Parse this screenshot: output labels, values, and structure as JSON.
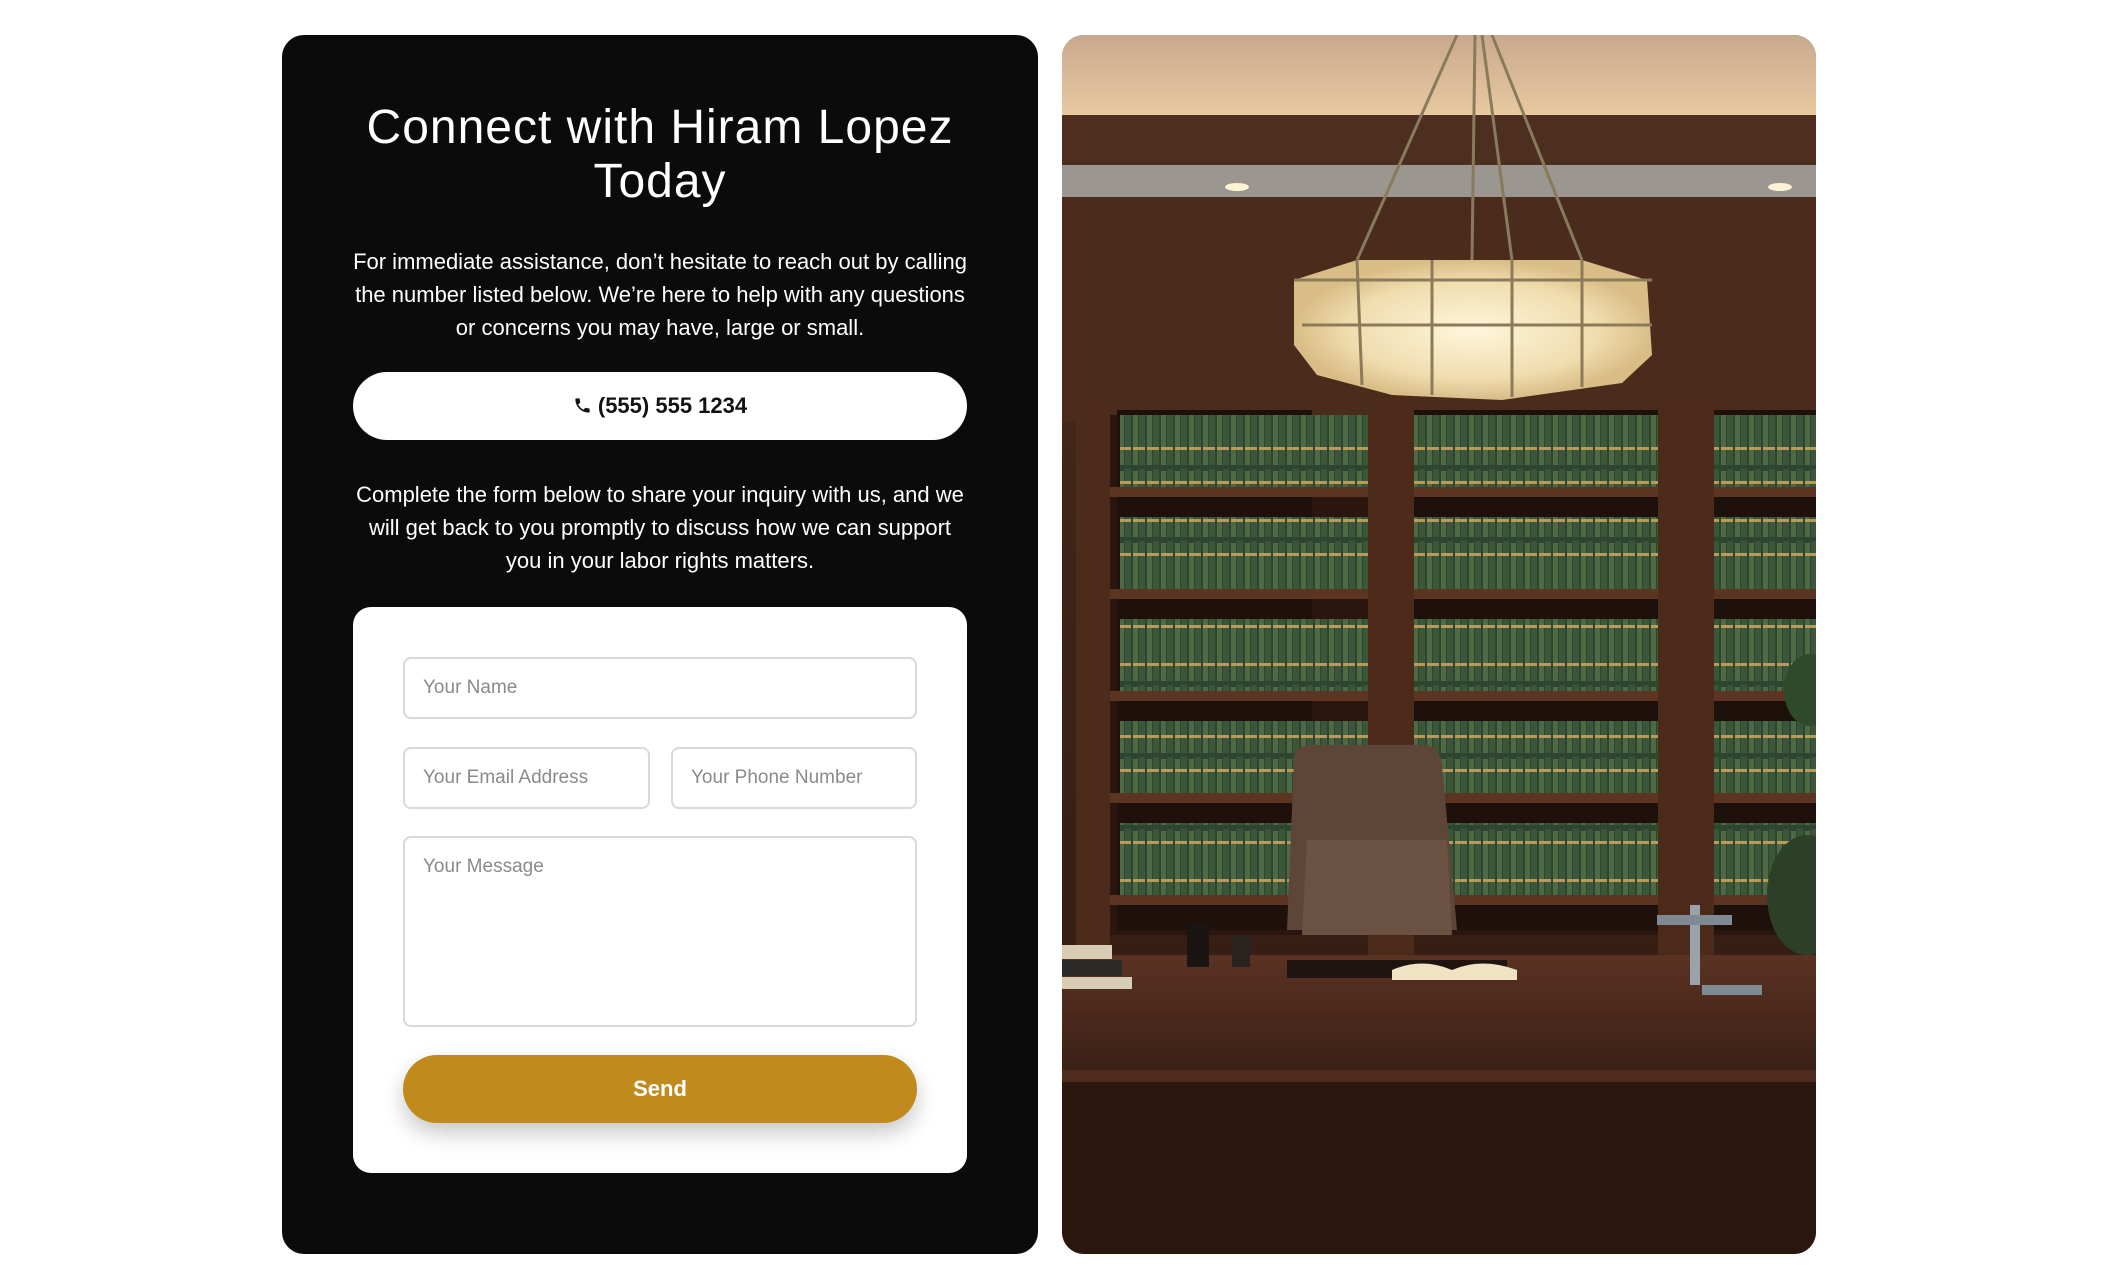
{
  "contact": {
    "heading_line1": "Connect with Hiram Lopez",
    "heading_line2": "Today",
    "intro": "For immediate assistance, don’t hesitate to reach out by calling the number listed below. We’re here to help with any questions or concerns you may have, large or small.",
    "phone_label": "(555) 555 1234",
    "phone_icon": "phone-icon",
    "form_intro": "Complete the form below to share your inquiry with us, and we will get back to you promptly to discuss how we can support you in your labor rights matters."
  },
  "form": {
    "name_placeholder": "Your Name",
    "email_placeholder": "Your Email Address",
    "phone_placeholder": "Your Phone Number",
    "message_placeholder": "Your Message",
    "send_label": "Send"
  },
  "colors": {
    "card_bg": "#0c0b0c",
    "accent": "#c18a1c",
    "text_light": "#ffffff"
  }
}
